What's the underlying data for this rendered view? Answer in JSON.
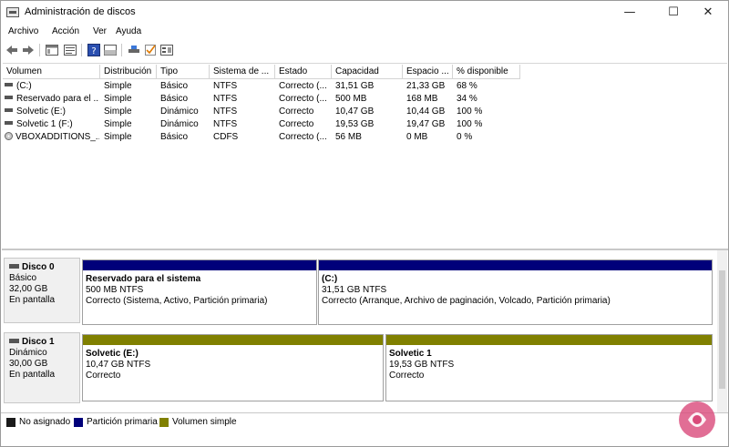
{
  "window": {
    "title": "Administración de discos"
  },
  "menu": [
    "Archivo",
    "Acción",
    "Ver",
    "Ayuda"
  ],
  "columns": [
    "Volumen",
    "Distribución",
    "Tipo",
    "Sistema de ...",
    "Estado",
    "Capacidad",
    "Espacio ...",
    "% disponible"
  ],
  "volumes": [
    {
      "icon": "volume-icon",
      "name": "(C:)",
      "layout": "Simple",
      "type": "Básico",
      "fs": "NTFS",
      "status": "Correcto (...",
      "capacity": "31,51 GB",
      "free": "21,33 GB",
      "pct": "68 %"
    },
    {
      "icon": "volume-icon",
      "name": "Reservado para el ...",
      "layout": "Simple",
      "type": "Básico",
      "fs": "NTFS",
      "status": "Correcto (...",
      "capacity": "500 MB",
      "free": "168 MB",
      "pct": "34 %"
    },
    {
      "icon": "volume-icon",
      "name": "Solvetic (E:)",
      "layout": "Simple",
      "type": "Dinámico",
      "fs": "NTFS",
      "status": "Correcto",
      "capacity": "10,47 GB",
      "free": "10,44 GB",
      "pct": "100 %"
    },
    {
      "icon": "volume-icon",
      "name": "Solvetic 1 (F:)",
      "layout": "Simple",
      "type": "Dinámico",
      "fs": "NTFS",
      "status": "Correcto",
      "capacity": "19,53 GB",
      "free": "19,47 GB",
      "pct": "100 %"
    },
    {
      "icon": "cd-icon",
      "name": "VBOXADDITIONS_...",
      "layout": "Simple",
      "type": "Básico",
      "fs": "CDFS",
      "status": "Correcto (...",
      "capacity": "56 MB",
      "free": "0 MB",
      "pct": "0 %"
    }
  ],
  "disks": [
    {
      "name": "Disco 0",
      "type": "Básico",
      "size": "32,00 GB",
      "status": "En pantalla",
      "partitions": [
        {
          "name": "Reservado para el sistema",
          "size": "500 MB NTFS",
          "status": "Correcto (Sistema, Activo, Partición primaria)",
          "kind": "primary"
        },
        {
          "name": "(C:)",
          "size": "31,51 GB NTFS",
          "status": "Correcto (Arranque, Archivo de paginación, Volcado, Partición primaria)",
          "kind": "primary"
        }
      ]
    },
    {
      "name": "Disco 1",
      "type": "Dinámico",
      "size": "30,00 GB",
      "status": "En pantalla",
      "partitions": [
        {
          "name": "Solvetic  (E:)",
          "size": "10,47 GB NTFS",
          "status": "Correcto",
          "kind": "simple"
        },
        {
          "name": "Solvetic 1",
          "size": "19,53 GB NTFS",
          "status": "Correcto",
          "kind": "simple"
        }
      ]
    }
  ],
  "legend": [
    {
      "label": "No asignado",
      "color": "#1a1a1a"
    },
    {
      "label": "Partición primaria",
      "color": "#00007a"
    },
    {
      "label": "Volumen simple",
      "color": "#808000"
    }
  ],
  "colors": {
    "primary": "#00007a",
    "simple": "#808000",
    "unallocated": "#1a1a1a"
  }
}
